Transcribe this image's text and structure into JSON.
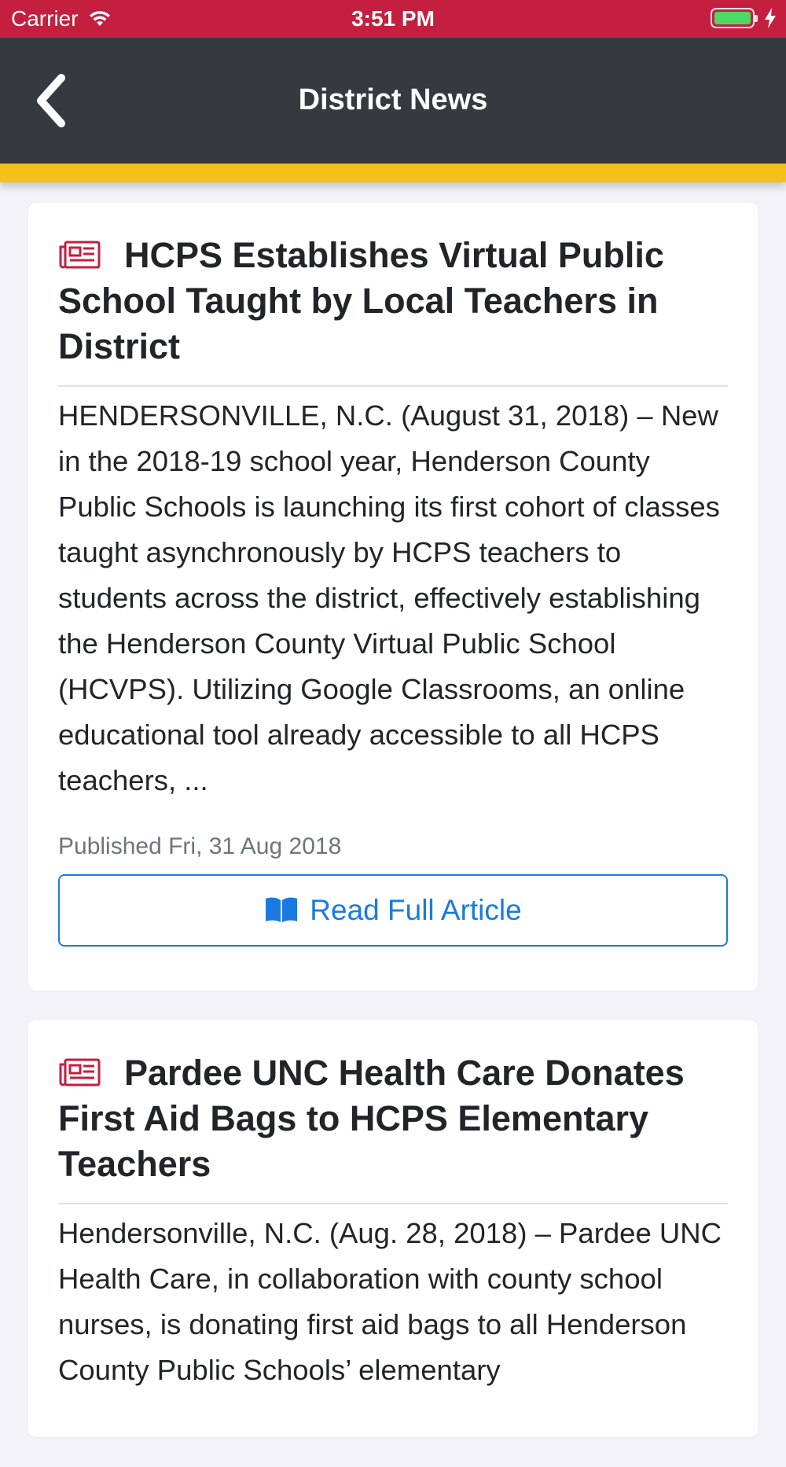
{
  "status_bar": {
    "carrier": "Carrier",
    "time": "3:51 PM",
    "icons": [
      "wifi-icon",
      "battery-icon",
      "charging-bolt-icon"
    ]
  },
  "nav": {
    "title": "District News",
    "back_icon": "chevron-left-icon"
  },
  "colors": {
    "status_bar": "#c41f3e",
    "nav_bar": "#343a40",
    "accent": "#f5c018",
    "icon_red": "#c41f3e",
    "link_blue": "#1a7ae0"
  },
  "articles": [
    {
      "icon": "newspaper-icon",
      "title": "HCPS Establishes Virtual Public School Taught by Local Teachers in District",
      "body": "HENDERSONVILLE, N.C. (August 31, 2018) – New in the 2018-19 school year, Henderson County Public Schools is launching its first cohort of classes taught asynchronously by HCPS teachers to students across the district, effectively establishing the Henderson County Virtual Public School (HCVPS). Utilizing Google Classrooms, an online educational tool already accessible to all HCPS teachers, ...",
      "published": "Published Fri, 31 Aug 2018",
      "button_label": "Read Full Article",
      "button_icon": "open-book-icon"
    },
    {
      "icon": "newspaper-icon",
      "title": "Pardee UNC Health Care Donates First Aid Bags to HCPS Elementary Teachers",
      "body": "Hendersonville, N.C. (Aug. 28, 2018) – Pardee UNC Health Care, in collaboration with county school nurses, is donating first aid bags to all Henderson County Public Schools’ elementary"
    }
  ]
}
